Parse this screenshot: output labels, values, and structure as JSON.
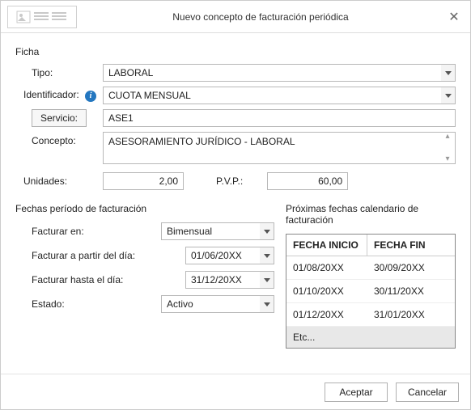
{
  "dialog": {
    "title": "Nuevo concepto de facturación periódica"
  },
  "ficha": {
    "section": "Ficha",
    "tipo_label": "Tipo:",
    "tipo_value": "LABORAL",
    "identificador_label": "Identificador:",
    "identificador_value": "CUOTA MENSUAL",
    "servicio_btn": "Servicio:",
    "servicio_value": "ASE1",
    "concepto_label": "Concepto:",
    "concepto_value": "ASESORAMIENTO JURÍDICO - LABORAL",
    "unidades_label": "Unidades:",
    "unidades_value": "2,00",
    "pvp_label": "P.V.P.:",
    "pvp_value": "60,00"
  },
  "periodo": {
    "section": "Fechas período de facturación",
    "facturar_en_label": "Facturar en:",
    "facturar_en_value": "Bimensual",
    "desde_label": "Facturar a partir del día:",
    "desde_value": "01/06/20XX",
    "hasta_label": "Facturar hasta el día:",
    "hasta_value": "31/12/20XX",
    "estado_label": "Estado:",
    "estado_value": "Activo"
  },
  "calendario": {
    "section": "Próximas fechas calendario de facturación",
    "col_inicio": "FECHA INICIO",
    "col_fin": "FECHA FIN",
    "rows": [
      {
        "inicio": "01/08/20XX",
        "fin": "30/09/20XX"
      },
      {
        "inicio": "01/10/20XX",
        "fin": "30/11/20XX"
      },
      {
        "inicio": "01/12/20XX",
        "fin": "31/01/20XX"
      }
    ],
    "etc": "Etc..."
  },
  "buttons": {
    "accept": "Aceptar",
    "cancel": "Cancelar"
  }
}
